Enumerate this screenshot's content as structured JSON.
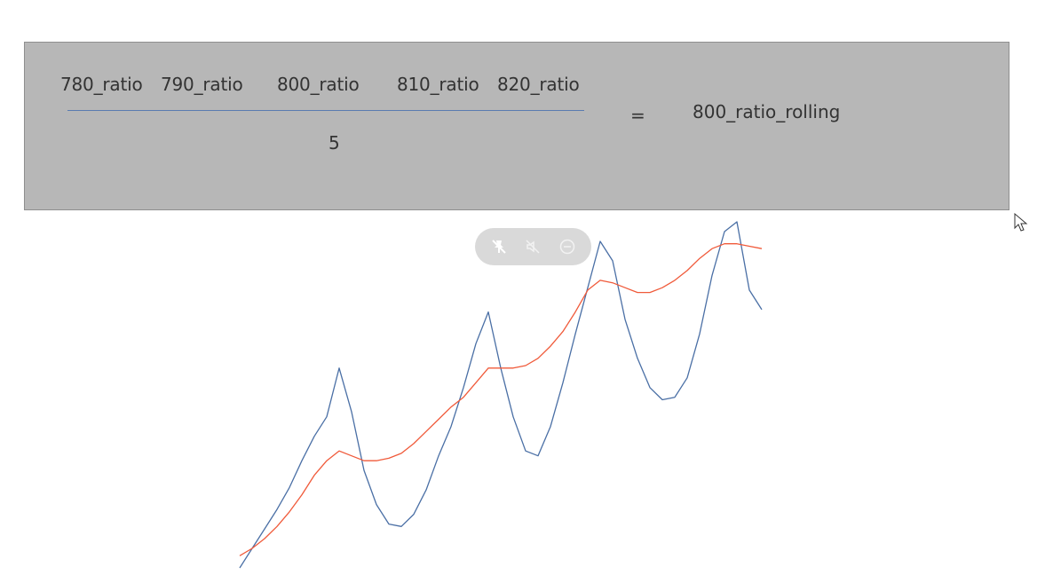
{
  "formula": {
    "numerator_terms": [
      "780_ratio",
      "790_ratio",
      "800_ratio",
      "810_ratio",
      "820_ratio"
    ],
    "denominator": "5",
    "equals": "=",
    "result": "800_ratio_rolling"
  },
  "media_controls": {
    "buttons": [
      "pin-off-icon",
      "volume-mute-icon",
      "minus-circle-icon"
    ]
  },
  "chart_data": {
    "type": "line",
    "title": "",
    "xlabel": "",
    "ylabel": "",
    "series": [
      {
        "color": "#4a6fa5",
        "values": [
          0,
          8,
          16,
          24,
          33,
          44,
          54,
          62,
          82,
          64,
          40,
          26,
          18,
          17,
          22,
          32,
          46,
          58,
          74,
          92,
          105,
          82,
          62,
          48,
          46,
          58,
          76,
          96,
          115,
          134,
          126,
          102,
          86,
          74,
          69,
          70,
          78,
          96,
          120,
          138,
          142,
          114,
          106
        ]
      },
      {
        "color": "#f05a3a",
        "values": [
          5,
          8,
          12,
          17,
          23,
          30,
          38,
          44,
          48,
          46,
          44,
          44,
          45,
          47,
          51,
          56,
          61,
          66,
          70,
          76,
          82,
          82,
          82,
          83,
          86,
          91,
          97,
          105,
          114,
          118,
          117,
          115,
          113,
          113,
          115,
          118,
          122,
          127,
          131,
          133,
          133,
          132,
          131
        ]
      }
    ],
    "grid": false,
    "legend": "none"
  },
  "colors": {
    "formula_background": "#b7b7b7",
    "fraction_line": "#5a7bb0",
    "series_blue": "#4a6fa5",
    "series_red": "#f05a3a"
  }
}
